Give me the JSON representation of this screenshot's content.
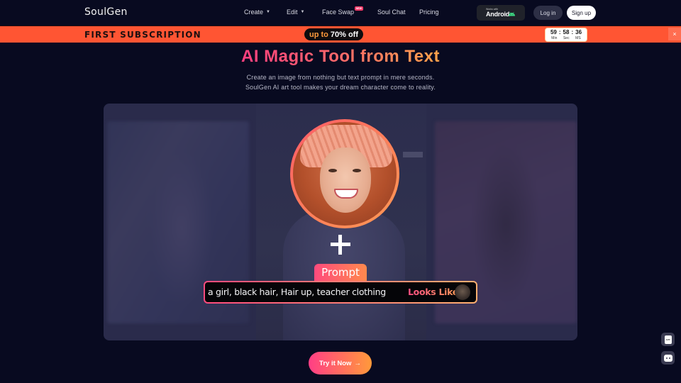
{
  "nav": {
    "logo": "SoulGen",
    "items": [
      {
        "label": "Create",
        "has_dropdown": true
      },
      {
        "label": "Edit",
        "has_dropdown": true
      },
      {
        "label": "Face Swap",
        "badge": "NEW"
      },
      {
        "label": "Soul Chat"
      },
      {
        "label": "Pricing"
      }
    ],
    "android": {
      "small": "Works with",
      "big": "Android"
    },
    "login": "Log in",
    "signup": "Sign up"
  },
  "promo": {
    "title": "FIRST SUBSCRIPTION",
    "pill_prefix": "up to",
    "pill_value": "70% off",
    "timer": {
      "min": "59",
      "sec": "58",
      "ms": "36",
      "sep": ":",
      "labels": [
        "Min",
        "Sec",
        "MS"
      ]
    },
    "close": "×"
  },
  "hero": {
    "title": "AI Magic Tool from Text",
    "subtitle_1": "Create an image from nothing but text prompt in mere seconds.",
    "subtitle_2": "SoulGen AI art tool makes your dream character come to reality."
  },
  "showcase": {
    "plus": "+",
    "prompt_tag": "Prompt",
    "prompt_text": "a girl, black hair, Hair up, teacher clothing",
    "looks_like": "Looks Like"
  },
  "cta": {
    "label": "Try it Now",
    "arrow": "→"
  },
  "floating": {
    "app_label": "APP"
  },
  "colors": {
    "background": "#080a20",
    "promo": "#ff5533",
    "accent_start": "#ff3e86",
    "accent_end": "#ff9a3a"
  }
}
